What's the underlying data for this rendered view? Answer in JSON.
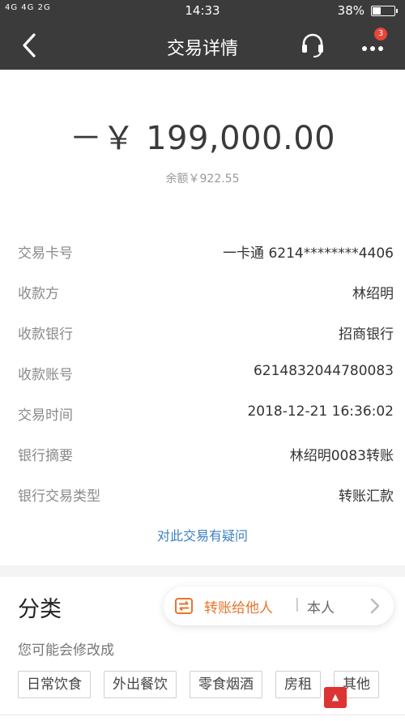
{
  "status_bar": {
    "signal": "4G 4G 2G",
    "time": "14:33",
    "battery": "38%",
    "battery_level": 0.38
  },
  "nav": {
    "title": "交易详情",
    "badge": "3",
    "icons": [
      "back-icon",
      "headset-icon",
      "more-icon"
    ]
  },
  "transaction": {
    "amount": "－￥ 199,000.00",
    "balance": "余额￥922.55",
    "rows": [
      {
        "label": "交易卡号",
        "value": "一卡通 6214********4406"
      },
      {
        "label": "收款方",
        "value": "林绍明"
      },
      {
        "label": "收款银行",
        "value": "招商银行"
      },
      {
        "label": "收款账号",
        "value": "6214832044780083"
      },
      {
        "label": "交易时间",
        "value": "2018-12-21 16:36:02"
      },
      {
        "label": "银行摘要",
        "value": "林绍明0083转账"
      },
      {
        "label": "银行交易类型",
        "value": "转账汇款"
      }
    ],
    "dispute_link": "对此交易有疑问"
  },
  "category": {
    "title": "分类",
    "subtitle": "您可能会修改成",
    "transfer_to_others": "转账给他人",
    "divider": "|",
    "self": "本人",
    "tags": [
      "日常饮食",
      "外出餐饮",
      "零食烟酒",
      "房租",
      "其他"
    ]
  },
  "colors": {
    "header_bg": "#3b3b3b",
    "link": "#3c7fc6",
    "accent_orange": "#e8742c",
    "badge_red": "#e8463a"
  }
}
